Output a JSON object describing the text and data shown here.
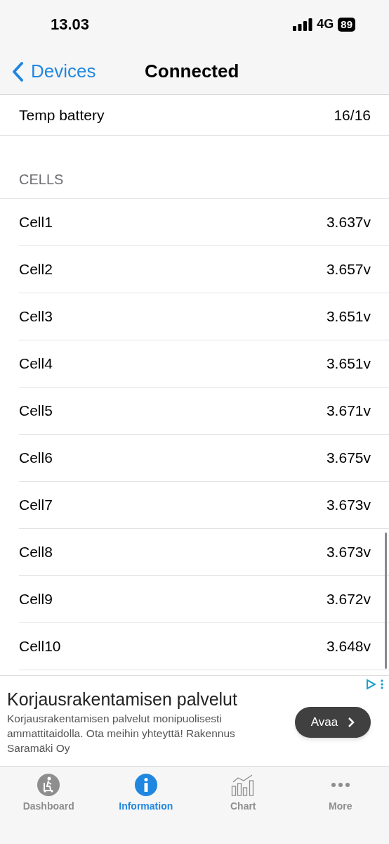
{
  "status_bar": {
    "time": "13.03",
    "network": "4G",
    "battery": "89"
  },
  "nav_bar": {
    "back": "Devices",
    "title": "Connected"
  },
  "top_row": {
    "label": "Temp battery",
    "value": "16/16"
  },
  "section": {
    "header": "CELLS",
    "rows": [
      {
        "label": "Cell1",
        "value": "3.637v"
      },
      {
        "label": "Cell2",
        "value": "3.657v"
      },
      {
        "label": "Cell3",
        "value": "3.651v"
      },
      {
        "label": "Cell4",
        "value": "3.651v"
      },
      {
        "label": "Cell5",
        "value": "3.671v"
      },
      {
        "label": "Cell6",
        "value": "3.675v"
      },
      {
        "label": "Cell7",
        "value": "3.673v"
      },
      {
        "label": "Cell8",
        "value": "3.673v"
      },
      {
        "label": "Cell9",
        "value": "3.672v"
      },
      {
        "label": "Cell10",
        "value": "3.648v"
      }
    ]
  },
  "ad": {
    "title": "Korjausrakentamisen palvelut",
    "body": "Korjausrakentamisen palvelut monipuolisesti ammattitaidolla. Ota meihin yhteyttä! Rakennus Saramäki Oy",
    "button": "Avaa"
  },
  "tab_bar": [
    {
      "label": "Dashboard",
      "selected": false
    },
    {
      "label": "Information",
      "selected": true
    },
    {
      "label": "Chart",
      "selected": false
    },
    {
      "label": "More",
      "selected": false
    }
  ]
}
